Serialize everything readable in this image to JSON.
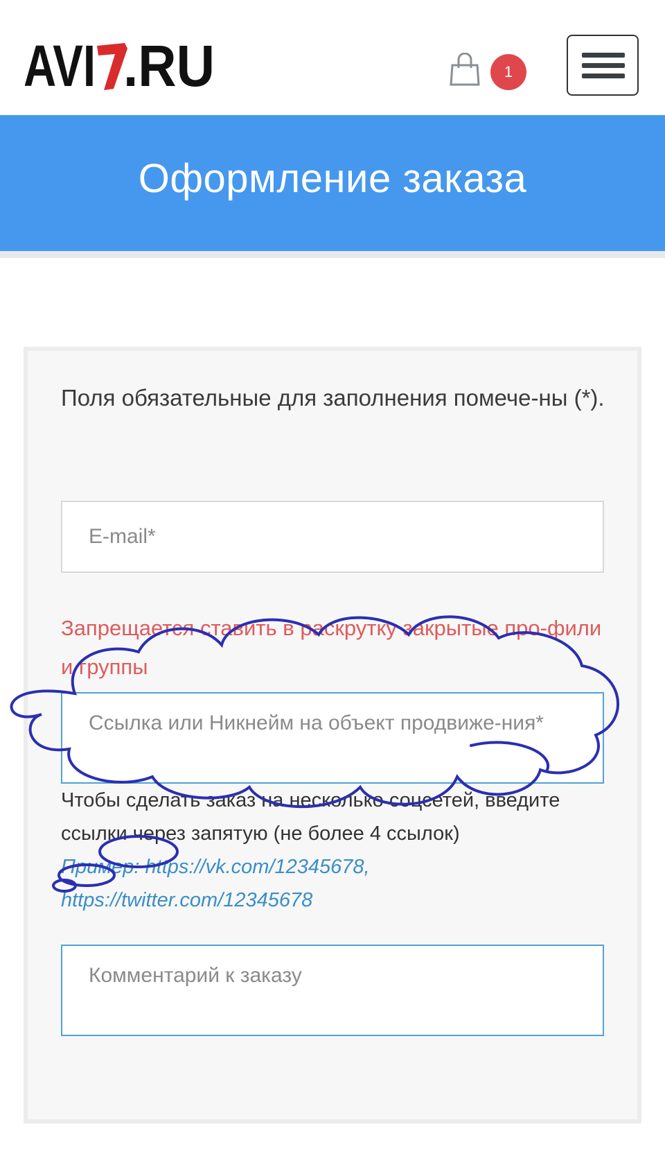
{
  "header": {
    "logo_text": "AVI7.RU",
    "cart_icon": "shopping-bag-icon",
    "cart_count": "1",
    "menu_icon": "hamburger-menu-icon"
  },
  "banner": {
    "title": "Оформление заказа"
  },
  "form": {
    "required_note": "Поля обязательные для заполнения помече-ны (*).",
    "email_placeholder": "E-mail*",
    "warning": "Запрещается ставить в раскрутку закрытые про-фили и группы",
    "link_placeholder": "Ссылка или Никнейм на объект продвиже-ния*",
    "hint": "Чтобы сделать заказ на несколько соцсетей, введите ссылки через запятую (не более 4 ссылок)",
    "example": "Пример: https://vk.com/12345678, https://twitter.com/12345678",
    "comment_placeholder": "Комментарий к заказу"
  },
  "colors": {
    "banner": "#4698ee",
    "badge": "#e0474c",
    "warning_text": "#df5b5b",
    "link_text": "#3a8ec8",
    "scribble": "#2b2fb0"
  }
}
